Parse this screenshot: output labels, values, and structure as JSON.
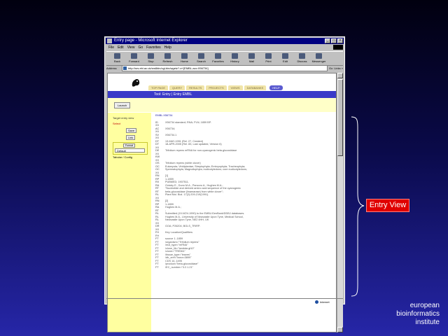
{
  "browser": {
    "title": "Entry page - Microsoft Internet Explorer",
    "window_buttons": [
      "_",
      "□",
      "×"
    ],
    "menu": [
      "File",
      "Edit",
      "View",
      "Go",
      "Favorites",
      "Help"
    ],
    "toolbar": [
      "Back",
      "Forward",
      "Stop",
      "Refresh",
      "Home",
      "Search",
      "Favorites",
      "History",
      "Mail",
      "Print",
      "Edit",
      "Discuss",
      "Messenger"
    ],
    "address_label": "Address",
    "address_value": "http://srs.ebi.ac.uk/srs6bin/cgi-bin/wgetz?-e+[EMBL-acc:X56734]",
    "go_label": "Go",
    "links_label": "Links »",
    "status_zone": "Internet"
  },
  "page": {
    "nav_tabs": [
      "TOP PAGE",
      "QUERY",
      "RESULTS",
      "PROJECTS",
      "VIEWS",
      "DATABANKS",
      "HELP"
    ],
    "title_bar": "Tool: Entry | Entry EMBL",
    "action_button": "Launch",
    "sidebar": {
      "target": "Target entry view",
      "selected": "Select",
      "buttons": [
        "Save",
        "Link"
      ],
      "format_label": "Format",
      "format_value": "Default",
      "config": "Tabular / Config"
    },
    "entry_id": "EMBL:X56734",
    "lines": [
      {
        "k": "ID",
        "v": "X56734     standard; RNA; PLN; 1859 BP."
      },
      {
        "k": "XX",
        "v": ""
      },
      {
        "k": "AC",
        "v": "X56734;"
      },
      {
        "k": "XX",
        "v": ""
      },
      {
        "k": "SV",
        "v": "X56734.1"
      },
      {
        "k": "XX",
        "v": ""
      },
      {
        "k": "DT",
        "v": "13-MAY-1991 (Rel. 27, Created)"
      },
      {
        "k": "DT",
        "v": "18-APR-2005 (Rel. 83, Last updated, Version 6)"
      },
      {
        "k": "XX",
        "v": ""
      },
      {
        "k": "DE",
        "v": "Trifolium repens mRNA for non-cyanogenic beta-glucosidase"
      },
      {
        "k": "XX",
        "v": ""
      },
      {
        "k": "KW",
        "v": ""
      },
      {
        "k": "XX",
        "v": ""
      },
      {
        "k": "OS",
        "v": "Trifolium repens (white clover)"
      },
      {
        "k": "OC",
        "v": "Eukaryota; Viridiplantae; Streptophyta; Embryophyta; Tracheophyta;"
      },
      {
        "k": "OC",
        "v": "Spermatophyta; Magnoliophyta; eudicotyledons; core eudicotyledons;"
      },
      {
        "k": "XX",
        "v": ""
      },
      {
        "k": "RN",
        "v": "[1]"
      },
      {
        "k": "RP",
        "v": "1-1859"
      },
      {
        "k": "RX",
        "v": "PUBMED; 1907511."
      },
      {
        "k": "RA",
        "v": "Oxtoby E., Dunn M.A., Pancoro A., Hughes M.A.;"
      },
      {
        "k": "RT",
        "v": "\"Nucleotide and derived amino acid sequence of the cyanogenic"
      },
      {
        "k": "RT",
        "v": "beta-glucosidase (linamarase) from white clover\";"
      },
      {
        "k": "RL",
        "v": "Plant Mol. Biol. 17(2):209-219(1991)."
      },
      {
        "k": "XX",
        "v": ""
      },
      {
        "k": "RN",
        "v": "[2]"
      },
      {
        "k": "RP",
        "v": "1-1859"
      },
      {
        "k": "RA",
        "v": "Hughes M.A.;"
      },
      {
        "k": "RT",
        "v": ";"
      },
      {
        "k": "RL",
        "v": "Submitted (19-NOV-1990) to the EMBL/GenBank/DDBJ databases."
      },
      {
        "k": "RL",
        "v": "Hughes M.A., University of Newcastle Upon Tyne, Medical School,"
      },
      {
        "k": "RL",
        "v": "Newcastle Upon Tyne, NE2 4HH, UK"
      },
      {
        "k": "XX",
        "v": ""
      },
      {
        "k": "DR",
        "v": "GOA; P26204; BGLS_TRIRP."
      },
      {
        "k": "XX",
        "v": ""
      },
      {
        "k": "FH",
        "v": "Key             Location/Qualifiers"
      },
      {
        "k": "FH",
        "v": ""
      },
      {
        "k": "FT",
        "v": "source          1..1859"
      },
      {
        "k": "FT",
        "v": "                /organism=\"Trifolium repens\""
      },
      {
        "k": "FT",
        "v": "                /mol_type=\"mRNA\""
      },
      {
        "k": "FT",
        "v": "                /clone_lib=\"lambda gt10\""
      },
      {
        "k": "FT",
        "v": "                /clone=\"TRE361\""
      },
      {
        "k": "FT",
        "v": "                /tissue_type=\"leaves\""
      },
      {
        "k": "FT",
        "v": "                /db_xref=\"taxon:3899\""
      },
      {
        "k": "FT",
        "v": "CDS             14..1495"
      },
      {
        "k": "FT",
        "v": "                /product=\"beta-glucosidase\""
      },
      {
        "k": "FT",
        "v": "                /EC_number=\"3.2.1.21\""
      }
    ]
  },
  "annotation": {
    "label": "Entry View"
  },
  "organization": {
    "lines": [
      "european",
      "bioinformatics",
      "institute"
    ]
  },
  "colors": {
    "nav_blue": "#3a3ac8",
    "label_red": "#e00000",
    "sidebar_yellow": "#ffffa0"
  }
}
